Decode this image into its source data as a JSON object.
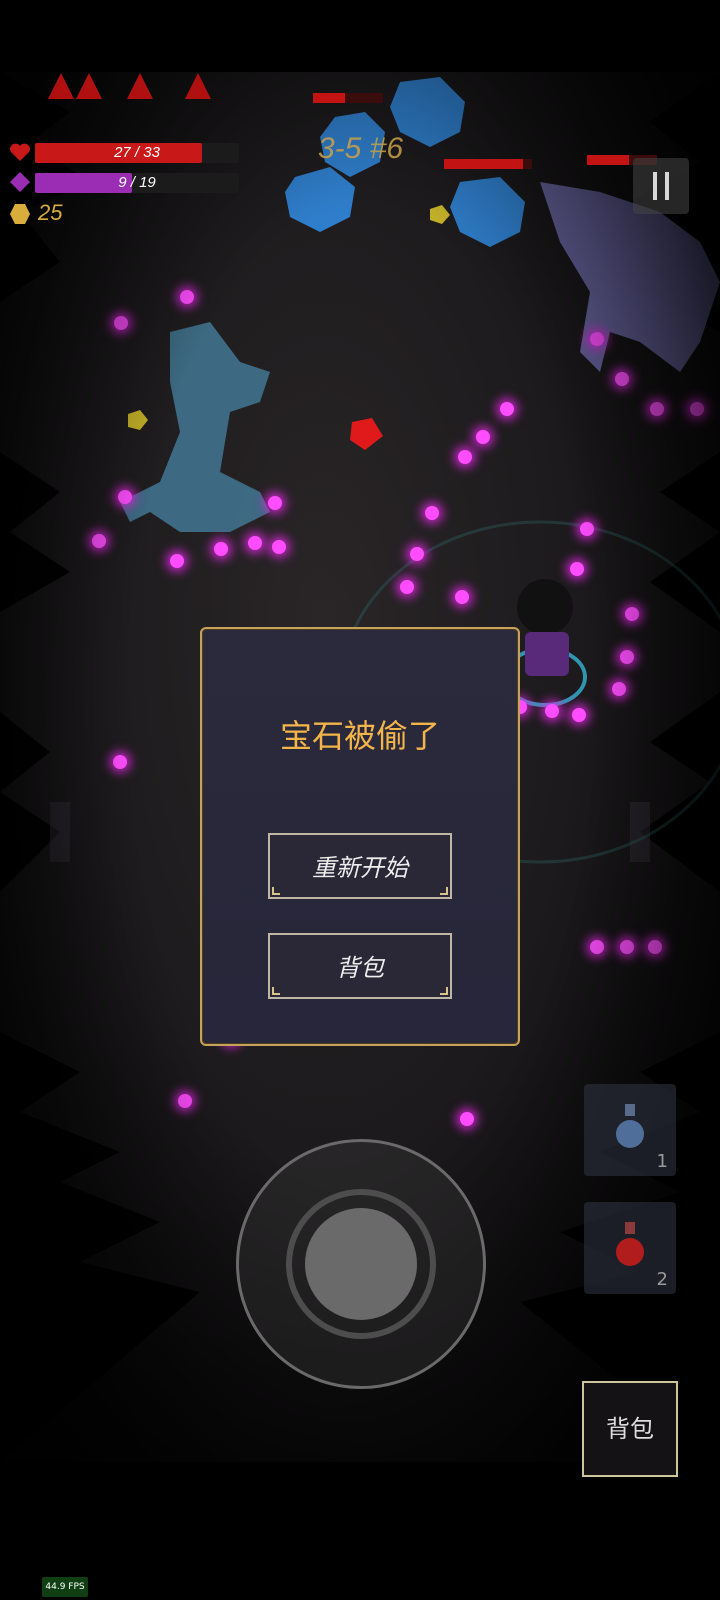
{
  "hud": {
    "hp": {
      "text": "27 / 33",
      "fraction": 0.818
    },
    "mana": {
      "text": "9 / 19",
      "fraction": 0.474
    },
    "gold": "25",
    "level": "3-5 #6"
  },
  "colors": {
    "hp": "#c81818",
    "mana": "#9b2db5",
    "gold": "#d9ad3c",
    "modal_title": "#f3b54a",
    "orb": "#ff4dff"
  },
  "icons": {
    "hp": "heart-icon",
    "mana": "diamond-icon",
    "gold": "coin-icon",
    "pause": "pause-icon",
    "potion": "potion-icon"
  },
  "dialog": {
    "title": "宝石被偷了",
    "restart_label": "重新开始",
    "bag_label": "背包"
  },
  "quickslots": [
    {
      "icon": "blue-potion-icon",
      "count": "1"
    },
    {
      "icon": "red-potion-icon",
      "count": "2"
    }
  ],
  "bag_button": {
    "label": "背包"
  },
  "fps": "44.9 FPS"
}
